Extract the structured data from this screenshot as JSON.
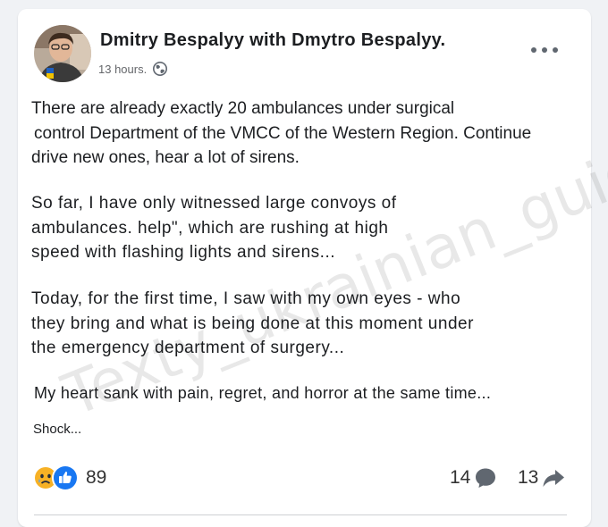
{
  "post": {
    "author": "Dmitry Bespalyy with Dmytro Bespalyy.",
    "time": "13 hours.",
    "paragraphs": [
      {
        "lines": [
          "There are already exactly 20 ambulances under surgical",
          "control Department of the VMCC of the Western Region. Continue",
          "drive new ones, hear a lot of sirens."
        ]
      },
      {
        "lines": [
          "So far, I have only witnessed large convoys of",
          "ambulances. help\", which are rushing at high",
          "speed with flashing lights and sirens..."
        ]
      },
      {
        "lines": [
          "Today, for the first time, I saw with my own eyes - who",
          "they bring and what is being done at this moment under",
          "the emergency department of surgery..."
        ]
      },
      {
        "lines": [
          "My heart sank with pain, regret, and horror at the same time..."
        ]
      }
    ],
    "closing": "Shock...",
    "watermark": "Texty_ukrainian_guide"
  },
  "stats": {
    "reactions_count": "89",
    "comments_count": "14",
    "shares_count": "13"
  },
  "icons": {
    "privacy": "globe-icon",
    "menu": "more-options-icon",
    "reaction_1": "sad-reaction-icon",
    "reaction_2": "like-reaction-icon",
    "comment": "comment-icon",
    "share": "share-icon"
  },
  "colors": {
    "like_blue": "#1877f2",
    "sad_yellow": "#f7b125",
    "icon_gray": "#606770"
  }
}
